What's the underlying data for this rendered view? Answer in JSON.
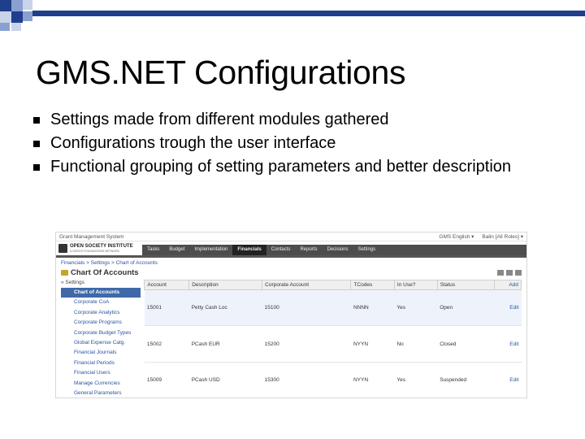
{
  "slide": {
    "title": "GMS.NET Configurations",
    "bullets": [
      "Settings made from different modules gathered",
      "Configurations trough the user interface",
      "Functional grouping of setting parameters and better description"
    ]
  },
  "colors": {
    "accent": "#1f3f8c",
    "nav_bg": "#4d4d4d",
    "link": "#2a54a0",
    "sidebar_active": "#3f69a8"
  },
  "app": {
    "system_name": "Grant Management System",
    "language_menu": "GMS English ▾",
    "user_menu": "Balin [All Roles] ▾",
    "logo_title": "OPEN SOCIETY INSTITUTE",
    "logo_subtitle": "& SOROS FOUNDATIONS NETWORK",
    "tabs": [
      "Tasks",
      "Budget",
      "Implementation",
      "Financials",
      "Contacts",
      "Reports",
      "Decisions",
      "Settings"
    ],
    "active_tab": "Financials",
    "breadcrumb": "Financials > Settings > Chart of Accounts",
    "page_heading": "Chart Of Accounts",
    "sidebar": {
      "header": "« Settings",
      "items": [
        "Chart of Accounts",
        "Corporate CoA",
        "Corporate Analytics",
        "Corporate Programs",
        "Corporate Budget Types",
        "Global Expense Catg.",
        "Financial Journals",
        "Financial Periods",
        "Financial Users",
        "Manage Currencies",
        "General Parameters"
      ],
      "active_index": 0
    },
    "table": {
      "columns": [
        "Account",
        "Description",
        "Corporate Account",
        "TCodes",
        "In Use?",
        "Status"
      ],
      "add_label": "Add",
      "rows": [
        {
          "account": "15001",
          "description": "Petty Cash Loc",
          "corporate_account": "15100",
          "tcodes": "NNNN",
          "in_use": "Yes",
          "status": "Open",
          "action": "Edit"
        },
        {
          "account": "15002",
          "description": "PCash EUR",
          "corporate_account": "15200",
          "tcodes": "NYYN",
          "in_use": "No",
          "status": "Closed",
          "action": "Edit"
        },
        {
          "account": "15009",
          "description": "PCash USD",
          "corporate_account": "15300",
          "tcodes": "NYYN",
          "in_use": "Yes",
          "status": "Suspended",
          "action": "Edit"
        }
      ]
    }
  }
}
